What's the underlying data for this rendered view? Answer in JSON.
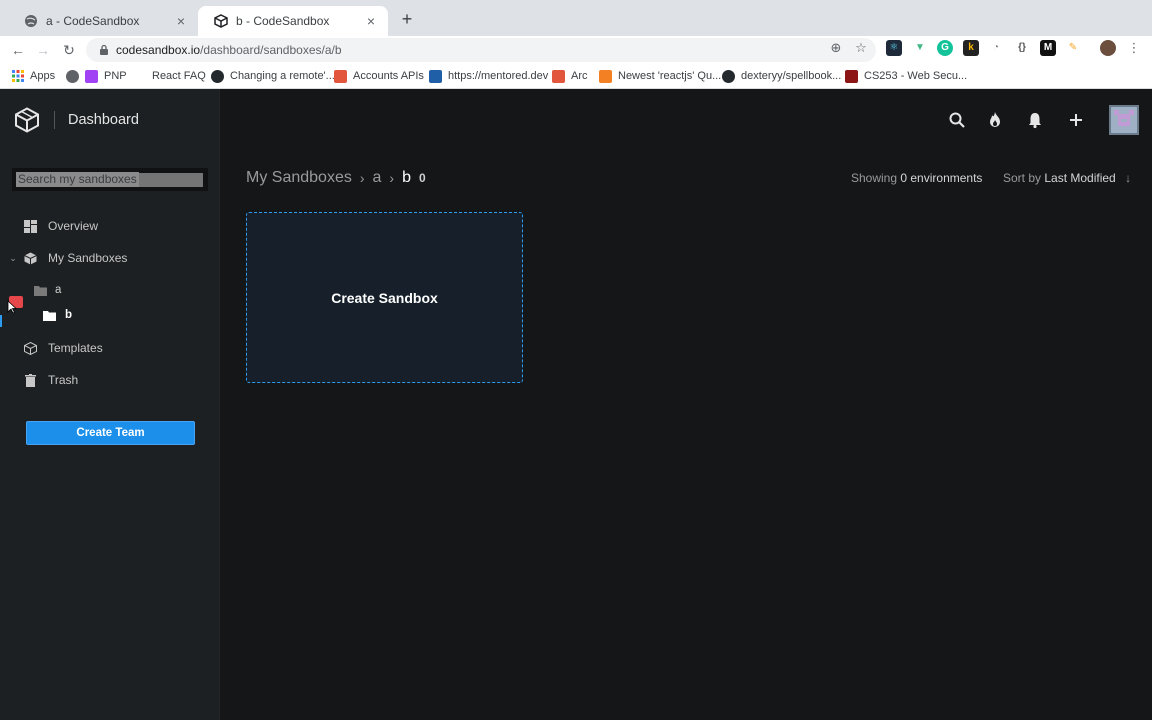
{
  "browser": {
    "tabs": [
      {
        "title": "a - CodeSandbox",
        "active": false
      },
      {
        "title": "b - CodeSandbox",
        "active": true
      }
    ],
    "url_host": "codesandbox.io",
    "url_path": "/dashboard/sandboxes/a/b",
    "bookmarks": [
      {
        "label": "Apps",
        "icon": "apps-grid-icon",
        "color": "#4285f4"
      },
      {
        "label": "PNP",
        "icon": "pnp-icon",
        "color": "#a142f4"
      },
      {
        "label": "React FAQ",
        "icon": "",
        "color": ""
      },
      {
        "label": "Changing a remote'...",
        "icon": "github-icon",
        "color": "#24292e"
      },
      {
        "label": "Accounts APIs",
        "icon": "accounts-icon",
        "color": "#e2563d"
      },
      {
        "label": "https://mentored.dev",
        "icon": "mentored-icon",
        "color": "#1f5fa8"
      },
      {
        "label": "Arc",
        "icon": "arc-icon",
        "color": "#e2563d"
      },
      {
        "label": "Newest 'reactjs' Qu...",
        "icon": "stackoverflow-icon",
        "color": "#f48024"
      },
      {
        "label": "dexteryy/spellbook...",
        "icon": "github-icon",
        "color": "#24292e"
      },
      {
        "label": "CS253 - Web Secu...",
        "icon": "stanford-icon",
        "color": "#8c1515"
      }
    ]
  },
  "app": {
    "title": "Dashboard",
    "search": {
      "placeholder": "Search my sandboxes",
      "value": ""
    },
    "sidebar": {
      "items": [
        {
          "label": "Overview",
          "icon": "overview-grid-icon"
        },
        {
          "label": "My Sandboxes",
          "icon": "sandbox-cube-icon"
        },
        {
          "label": "Templates",
          "icon": "template-cube-icon"
        },
        {
          "label": "Trash",
          "icon": "trash-icon"
        }
      ],
      "folders": [
        {
          "label": "a",
          "icon": "folder-icon"
        },
        {
          "label": "b",
          "icon": "folder-icon"
        }
      ],
      "create_team_label": "Create Team"
    },
    "breadcrumb": {
      "root": "My Sandboxes",
      "parent": "a",
      "current": "b",
      "count": "0"
    },
    "showing": {
      "prefix": "Showing",
      "value": "0 environments"
    },
    "sort": {
      "prefix": "Sort by",
      "value": "Last Modified"
    },
    "create_sandbox_label": "Create Sandbox",
    "colors": {
      "accent": "#2d9bf0",
      "button": "#1b8fe9",
      "sidebar_bg": "#1c2022",
      "main_bg": "#151618"
    }
  }
}
